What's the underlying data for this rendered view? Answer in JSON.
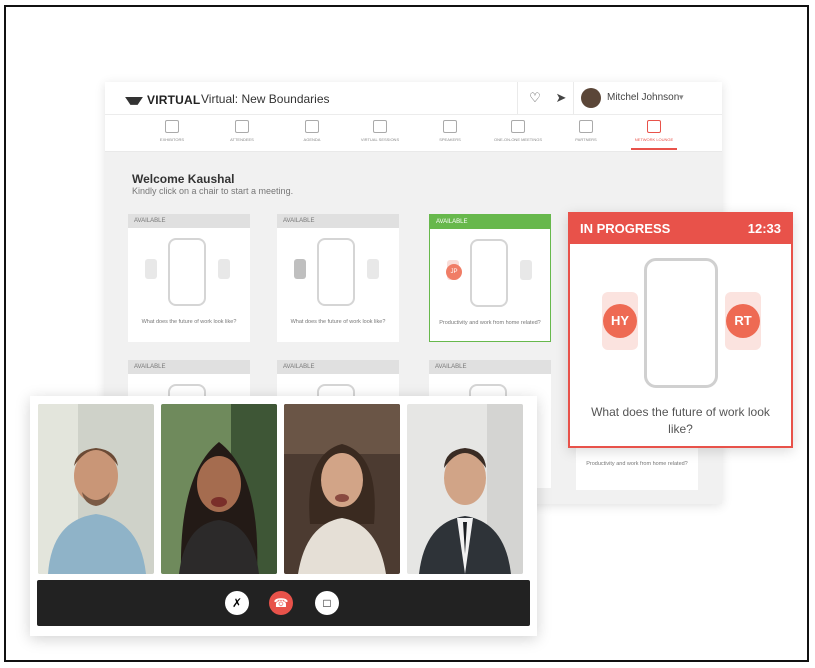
{
  "app": {
    "brand": "VIRTUAL",
    "title": "Virtual: New Boundaries",
    "user_name": "Mitchel Johnson"
  },
  "nav": [
    {
      "label": "EXHIBITORS"
    },
    {
      "label": "ATTENDEES"
    },
    {
      "label": "AGENDA"
    },
    {
      "label": "VIRTUAL SESSIONS"
    },
    {
      "label": "SPEAKERS"
    },
    {
      "label": "ONE-ON-ONE MEETINGS"
    },
    {
      "label": "PARTNERS"
    },
    {
      "label": "NETWORK LOUNGE"
    }
  ],
  "welcome": {
    "title": "Welcome Kaushal",
    "subtitle": "Kindly click on a chair to start a meeting."
  },
  "tables": [
    {
      "status": "AVAILABLE",
      "question": "What does the future of work look like?"
    },
    {
      "status": "AVAILABLE",
      "question": "What does the future of work look like?"
    },
    {
      "status": "AVAILABLE",
      "question": "Productivity and work from home related?",
      "initials": "JP"
    },
    {
      "status": "AVAILABLE"
    },
    {
      "status": "AVAILABLE"
    },
    {
      "status": "AVAILABLE",
      "question": "Productivity and work from home related?"
    }
  ],
  "in_progress": {
    "status": "IN PROGRESS",
    "timer": "12:33",
    "left_initials": "HY",
    "right_initials": "RT",
    "question": "What does the future of work look like?"
  },
  "colors": {
    "accent": "#e8524a",
    "available_green": "#67b84c"
  },
  "call_controls": {
    "mute_icon": "mic-off-icon",
    "end_icon": "phone-hangup-icon",
    "chat_icon": "chat-icon"
  }
}
